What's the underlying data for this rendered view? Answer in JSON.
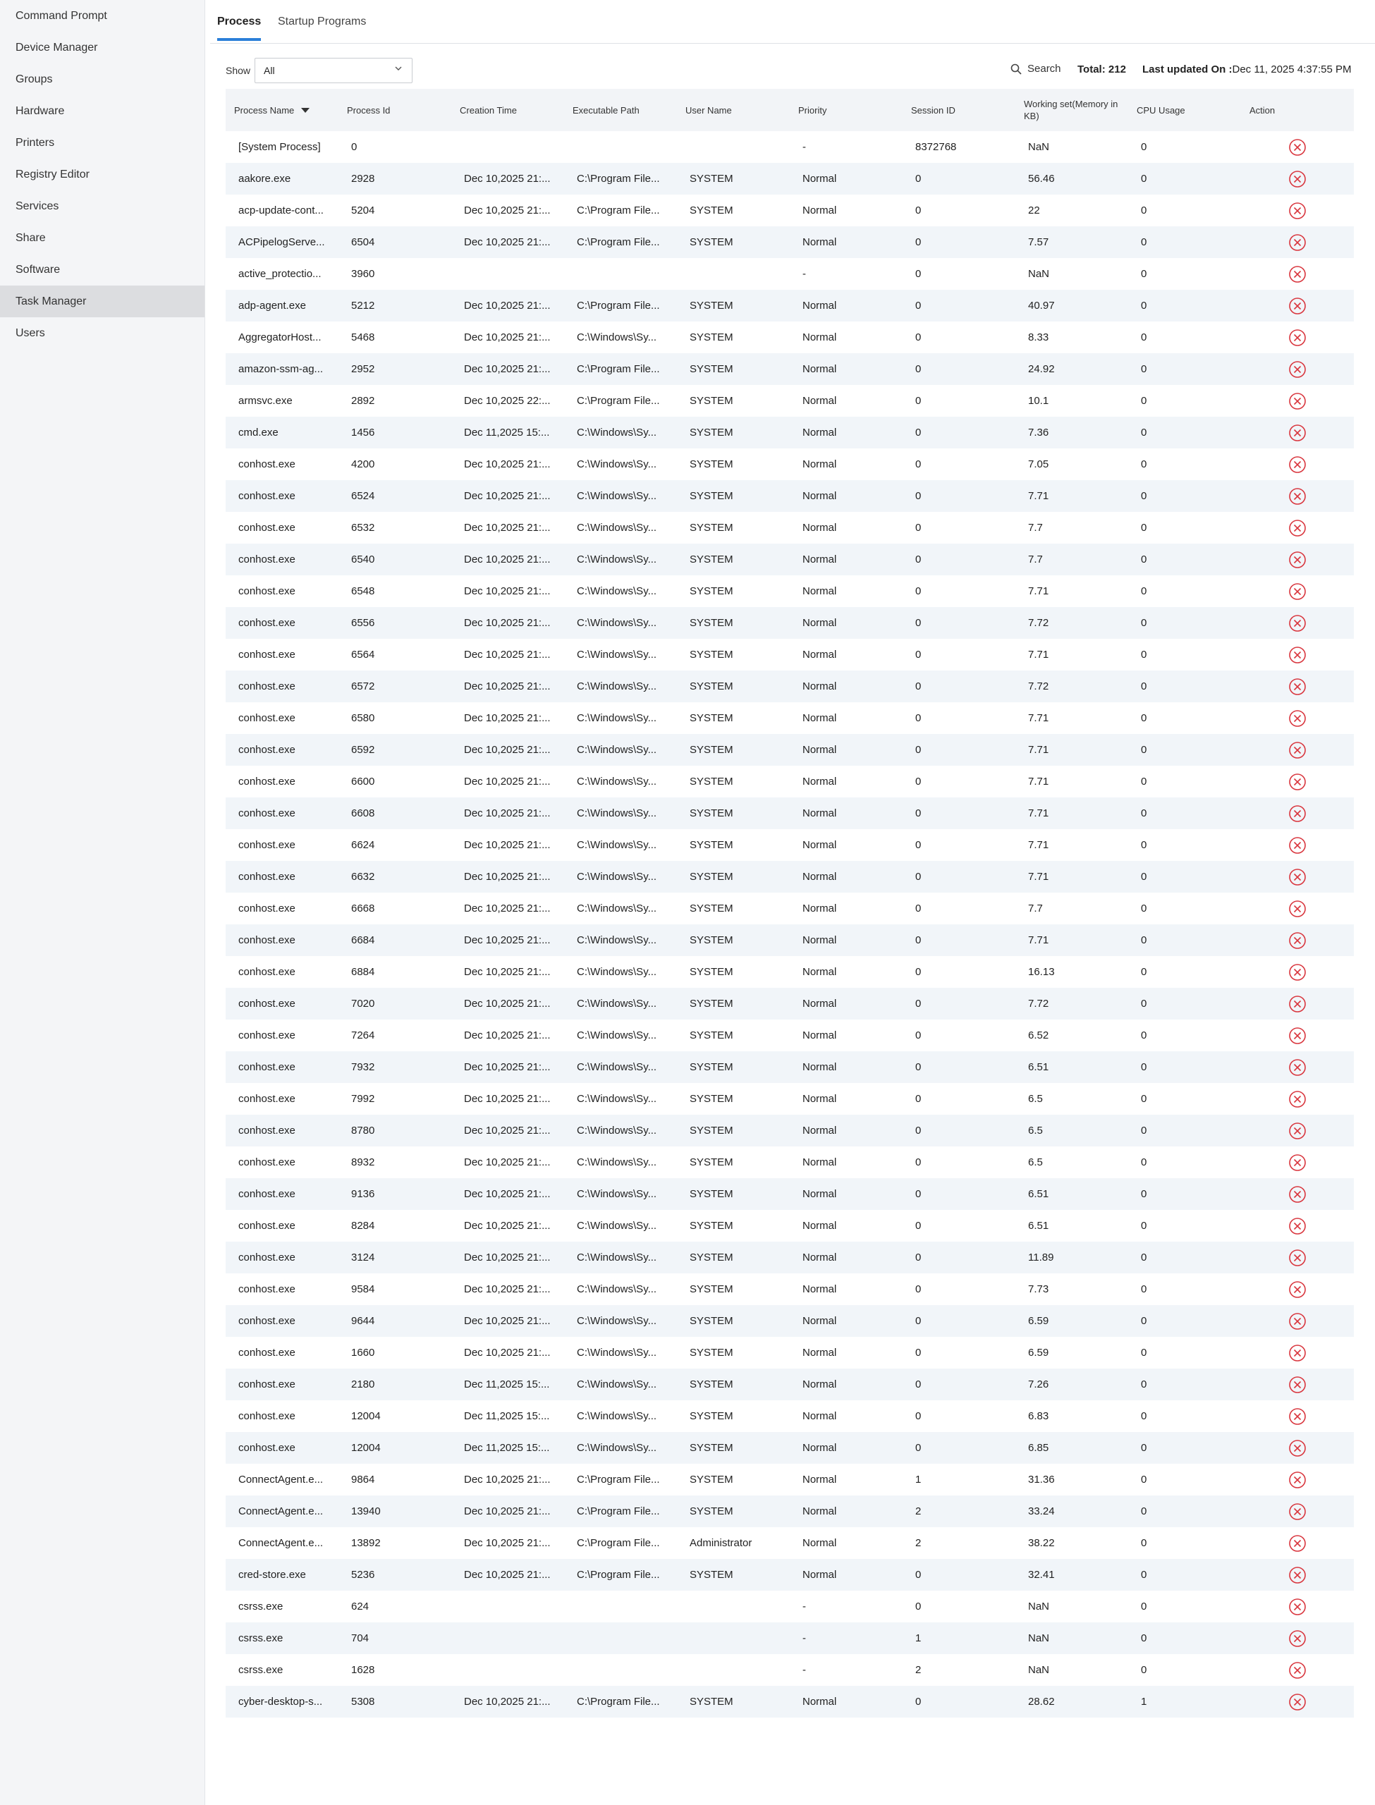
{
  "sidebar": {
    "items": [
      "Command Prompt",
      "Device Manager",
      "Groups",
      "Hardware",
      "Printers",
      "Registry Editor",
      "Services",
      "Share",
      "Software",
      "Task Manager",
      "Users"
    ],
    "active": "Task Manager"
  },
  "tabs": {
    "process": "Process",
    "startup": "Startup Programs",
    "active": "Process"
  },
  "toolbar": {
    "show_label": "Show",
    "show_value": "All",
    "search_label": "Search",
    "total": "Total: 212",
    "updated_label": "Last updated On :",
    "updated_value": "Dec 11, 2025 4:37:55 PM"
  },
  "icons": {
    "search": "search-icon",
    "dropdown": "chevron-down-icon",
    "sort": "sort-desc-icon",
    "kill": "close-circle-icon"
  },
  "colors": {
    "accent": "#2b7fd9",
    "kill": "#d9363e",
    "header_bg": "#f2f4f7",
    "stripe": "#f1f5f9",
    "sidebar_bg": "#f4f5f7",
    "sidebar_active": "#dcdde0"
  },
  "table": {
    "columns": [
      "Process Name",
      "Process Id",
      "Creation Time",
      "Executable Path",
      "User Name",
      "Priority",
      "Session ID",
      "Working set(Memory in KB)",
      "CPU Usage",
      "Action"
    ],
    "sorted_by": "Process Name",
    "rows": [
      [
        "[System Process]",
        "0",
        "",
        "",
        "",
        "-",
        "8372768",
        "NaN",
        "0"
      ],
      [
        "aakore.exe",
        "2928",
        "Dec 10,2025 21:...",
        "C:\\Program File...",
        "SYSTEM",
        "Normal",
        "0",
        "56.46",
        "0"
      ],
      [
        "acp-update-cont...",
        "5204",
        "Dec 10,2025 21:...",
        "C:\\Program File...",
        "SYSTEM",
        "Normal",
        "0",
        "22",
        "0"
      ],
      [
        "ACPipelogServe...",
        "6504",
        "Dec 10,2025 21:...",
        "C:\\Program File...",
        "SYSTEM",
        "Normal",
        "0",
        "7.57",
        "0"
      ],
      [
        "active_protectio...",
        "3960",
        "",
        "",
        "",
        "-",
        "0",
        "NaN",
        "0"
      ],
      [
        "adp-agent.exe",
        "5212",
        "Dec 10,2025 21:...",
        "C:\\Program File...",
        "SYSTEM",
        "Normal",
        "0",
        "40.97",
        "0"
      ],
      [
        "AggregatorHost...",
        "5468",
        "Dec 10,2025 21:...",
        "C:\\Windows\\Sy...",
        "SYSTEM",
        "Normal",
        "0",
        "8.33",
        "0"
      ],
      [
        "amazon-ssm-ag...",
        "2952",
        "Dec 10,2025 21:...",
        "C:\\Program File...",
        "SYSTEM",
        "Normal",
        "0",
        "24.92",
        "0"
      ],
      [
        "armsvc.exe",
        "2892",
        "Dec 10,2025 22:...",
        "C:\\Program File...",
        "SYSTEM",
        "Normal",
        "0",
        "10.1",
        "0"
      ],
      [
        "cmd.exe",
        "1456",
        "Dec 11,2025 15:...",
        "C:\\Windows\\Sy...",
        "SYSTEM",
        "Normal",
        "0",
        "7.36",
        "0"
      ],
      [
        "conhost.exe",
        "4200",
        "Dec 10,2025 21:...",
        "C:\\Windows\\Sy...",
        "SYSTEM",
        "Normal",
        "0",
        "7.05",
        "0"
      ],
      [
        "conhost.exe",
        "6524",
        "Dec 10,2025 21:...",
        "C:\\Windows\\Sy...",
        "SYSTEM",
        "Normal",
        "0",
        "7.71",
        "0"
      ],
      [
        "conhost.exe",
        "6532",
        "Dec 10,2025 21:...",
        "C:\\Windows\\Sy...",
        "SYSTEM",
        "Normal",
        "0",
        "7.7",
        "0"
      ],
      [
        "conhost.exe",
        "6540",
        "Dec 10,2025 21:...",
        "C:\\Windows\\Sy...",
        "SYSTEM",
        "Normal",
        "0",
        "7.7",
        "0"
      ],
      [
        "conhost.exe",
        "6548",
        "Dec 10,2025 21:...",
        "C:\\Windows\\Sy...",
        "SYSTEM",
        "Normal",
        "0",
        "7.71",
        "0"
      ],
      [
        "conhost.exe",
        "6556",
        "Dec 10,2025 21:...",
        "C:\\Windows\\Sy...",
        "SYSTEM",
        "Normal",
        "0",
        "7.72",
        "0"
      ],
      [
        "conhost.exe",
        "6564",
        "Dec 10,2025 21:...",
        "C:\\Windows\\Sy...",
        "SYSTEM",
        "Normal",
        "0",
        "7.71",
        "0"
      ],
      [
        "conhost.exe",
        "6572",
        "Dec 10,2025 21:...",
        "C:\\Windows\\Sy...",
        "SYSTEM",
        "Normal",
        "0",
        "7.72",
        "0"
      ],
      [
        "conhost.exe",
        "6580",
        "Dec 10,2025 21:...",
        "C:\\Windows\\Sy...",
        "SYSTEM",
        "Normal",
        "0",
        "7.71",
        "0"
      ],
      [
        "conhost.exe",
        "6592",
        "Dec 10,2025 21:...",
        "C:\\Windows\\Sy...",
        "SYSTEM",
        "Normal",
        "0",
        "7.71",
        "0"
      ],
      [
        "conhost.exe",
        "6600",
        "Dec 10,2025 21:...",
        "C:\\Windows\\Sy...",
        "SYSTEM",
        "Normal",
        "0",
        "7.71",
        "0"
      ],
      [
        "conhost.exe",
        "6608",
        "Dec 10,2025 21:...",
        "C:\\Windows\\Sy...",
        "SYSTEM",
        "Normal",
        "0",
        "7.71",
        "0"
      ],
      [
        "conhost.exe",
        "6624",
        "Dec 10,2025 21:...",
        "C:\\Windows\\Sy...",
        "SYSTEM",
        "Normal",
        "0",
        "7.71",
        "0"
      ],
      [
        "conhost.exe",
        "6632",
        "Dec 10,2025 21:...",
        "C:\\Windows\\Sy...",
        "SYSTEM",
        "Normal",
        "0",
        "7.71",
        "0"
      ],
      [
        "conhost.exe",
        "6668",
        "Dec 10,2025 21:...",
        "C:\\Windows\\Sy...",
        "SYSTEM",
        "Normal",
        "0",
        "7.7",
        "0"
      ],
      [
        "conhost.exe",
        "6684",
        "Dec 10,2025 21:...",
        "C:\\Windows\\Sy...",
        "SYSTEM",
        "Normal",
        "0",
        "7.71",
        "0"
      ],
      [
        "conhost.exe",
        "6884",
        "Dec 10,2025 21:...",
        "C:\\Windows\\Sy...",
        "SYSTEM",
        "Normal",
        "0",
        "16.13",
        "0"
      ],
      [
        "conhost.exe",
        "7020",
        "Dec 10,2025 21:...",
        "C:\\Windows\\Sy...",
        "SYSTEM",
        "Normal",
        "0",
        "7.72",
        "0"
      ],
      [
        "conhost.exe",
        "7264",
        "Dec 10,2025 21:...",
        "C:\\Windows\\Sy...",
        "SYSTEM",
        "Normal",
        "0",
        "6.52",
        "0"
      ],
      [
        "conhost.exe",
        "7932",
        "Dec 10,2025 21:...",
        "C:\\Windows\\Sy...",
        "SYSTEM",
        "Normal",
        "0",
        "6.51",
        "0"
      ],
      [
        "conhost.exe",
        "7992",
        "Dec 10,2025 21:...",
        "C:\\Windows\\Sy...",
        "SYSTEM",
        "Normal",
        "0",
        "6.5",
        "0"
      ],
      [
        "conhost.exe",
        "8780",
        "Dec 10,2025 21:...",
        "C:\\Windows\\Sy...",
        "SYSTEM",
        "Normal",
        "0",
        "6.5",
        "0"
      ],
      [
        "conhost.exe",
        "8932",
        "Dec 10,2025 21:...",
        "C:\\Windows\\Sy...",
        "SYSTEM",
        "Normal",
        "0",
        "6.5",
        "0"
      ],
      [
        "conhost.exe",
        "9136",
        "Dec 10,2025 21:...",
        "C:\\Windows\\Sy...",
        "SYSTEM",
        "Normal",
        "0",
        "6.51",
        "0"
      ],
      [
        "conhost.exe",
        "8284",
        "Dec 10,2025 21:...",
        "C:\\Windows\\Sy...",
        "SYSTEM",
        "Normal",
        "0",
        "6.51",
        "0"
      ],
      [
        "conhost.exe",
        "3124",
        "Dec 10,2025 21:...",
        "C:\\Windows\\Sy...",
        "SYSTEM",
        "Normal",
        "0",
        "11.89",
        "0"
      ],
      [
        "conhost.exe",
        "9584",
        "Dec 10,2025 21:...",
        "C:\\Windows\\Sy...",
        "SYSTEM",
        "Normal",
        "0",
        "7.73",
        "0"
      ],
      [
        "conhost.exe",
        "9644",
        "Dec 10,2025 21:...",
        "C:\\Windows\\Sy...",
        "SYSTEM",
        "Normal",
        "0",
        "6.59",
        "0"
      ],
      [
        "conhost.exe",
        "1660",
        "Dec 10,2025 21:...",
        "C:\\Windows\\Sy...",
        "SYSTEM",
        "Normal",
        "0",
        "6.59",
        "0"
      ],
      [
        "conhost.exe",
        "2180",
        "Dec 11,2025 15:...",
        "C:\\Windows\\Sy...",
        "SYSTEM",
        "Normal",
        "0",
        "7.26",
        "0"
      ],
      [
        "conhost.exe",
        "12004",
        "Dec 11,2025 15:...",
        "C:\\Windows\\Sy...",
        "SYSTEM",
        "Normal",
        "0",
        "6.83",
        "0"
      ],
      [
        "conhost.exe",
        "12004",
        "Dec 11,2025 15:...",
        "C:\\Windows\\Sy...",
        "SYSTEM",
        "Normal",
        "0",
        "6.85",
        "0"
      ],
      [
        "ConnectAgent.e...",
        "9864",
        "Dec 10,2025 21:...",
        "C:\\Program File...",
        "SYSTEM",
        "Normal",
        "1",
        "31.36",
        "0"
      ],
      [
        "ConnectAgent.e...",
        "13940",
        "Dec 10,2025 21:...",
        "C:\\Program File...",
        "SYSTEM",
        "Normal",
        "2",
        "33.24",
        "0"
      ],
      [
        "ConnectAgent.e...",
        "13892",
        "Dec 10,2025 21:...",
        "C:\\Program File...",
        "Administrator",
        "Normal",
        "2",
        "38.22",
        "0"
      ],
      [
        "cred-store.exe",
        "5236",
        "Dec 10,2025 21:...",
        "C:\\Program File...",
        "SYSTEM",
        "Normal",
        "0",
        "32.41",
        "0"
      ],
      [
        "csrss.exe",
        "624",
        "",
        "",
        "",
        "-",
        "0",
        "NaN",
        "0"
      ],
      [
        "csrss.exe",
        "704",
        "",
        "",
        "",
        "-",
        "1",
        "NaN",
        "0"
      ],
      [
        "csrss.exe",
        "1628",
        "",
        "",
        "",
        "-",
        "2",
        "NaN",
        "0"
      ],
      [
        "cyber-desktop-s...",
        "5308",
        "Dec 10,2025 21:...",
        "C:\\Program File...",
        "SYSTEM",
        "Normal",
        "0",
        "28.62",
        "1"
      ]
    ]
  }
}
